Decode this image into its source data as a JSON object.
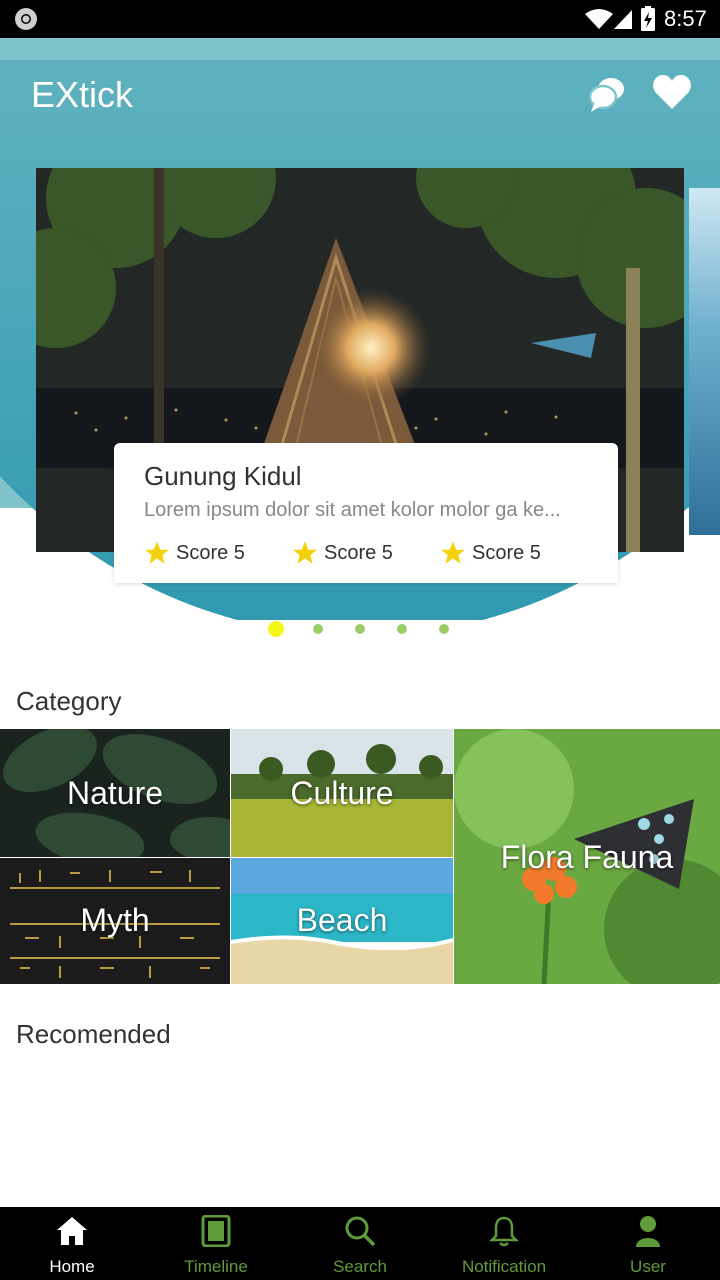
{
  "status_bar": {
    "time": "8:57"
  },
  "header": {
    "title": "EXtick",
    "icons": [
      "chat-bubbles-icon",
      "heart-icon"
    ]
  },
  "carousel": {
    "active_index": 0,
    "slide_count": 5,
    "card": {
      "title": "Gunung Kidul",
      "description": "Lorem ipsum dolor sit amet kolor molor ga ke...",
      "scores": [
        "Score 5",
        "Score 5",
        "Score 5"
      ]
    }
  },
  "category": {
    "title": "Category",
    "items": [
      "Nature",
      "Culture",
      "Myth",
      "Beach",
      "Flora Fauna"
    ]
  },
  "recommended": {
    "title": "Recomended"
  },
  "bottom_nav": {
    "active": "Home",
    "items": [
      "Home",
      "Timeline",
      "Search",
      "Notification",
      "User"
    ]
  },
  "colors": {
    "header": "#7ec4ca",
    "bowl": "#3a9db5",
    "nav_inactive": "#5f9b3a",
    "star": "#f5d10a",
    "dot_active": "#f5f51a",
    "dot": "#9ccc65"
  }
}
